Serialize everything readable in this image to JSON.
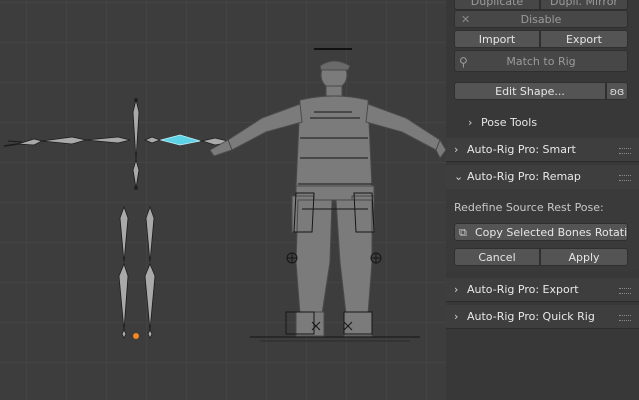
{
  "panel": {
    "duplicate_label": "Duplicate",
    "dupli_mirror_label": "Dupli. Mirror",
    "disable_label": "Disable",
    "import_label": "Import",
    "export_label": "Export",
    "match_to_rig_label": "Match to Rig",
    "edit_shape_label": "Edit Shape...",
    "pose_tools_label": "Pose Tools",
    "sections": {
      "smart": "Auto-Rig Pro: Smart",
      "remap": "Auto-Rig Pro: Remap",
      "export": "Auto-Rig Pro: Export",
      "quick_rig": "Auto-Rig Pro: Quick Rig"
    },
    "remap": {
      "redefine_label": "Redefine Source Rest Pose:",
      "copy_rotation_label": "Copy Selected Bones Rotation",
      "cancel_label": "Cancel",
      "apply_label": "Apply"
    }
  },
  "colors": {
    "viewport_bg": "#3d3d3d",
    "panel_bg": "#383838",
    "button_bg": "#545454",
    "selected_bone": "#5fd3e6",
    "origin_marker": "#f08a1e"
  },
  "icons": [
    "close-icon",
    "match-rig-icon",
    "butterfly-icon",
    "chevron-right-icon",
    "chevron-down-icon",
    "copy-bones-icon",
    "drag-grip-icon"
  ]
}
